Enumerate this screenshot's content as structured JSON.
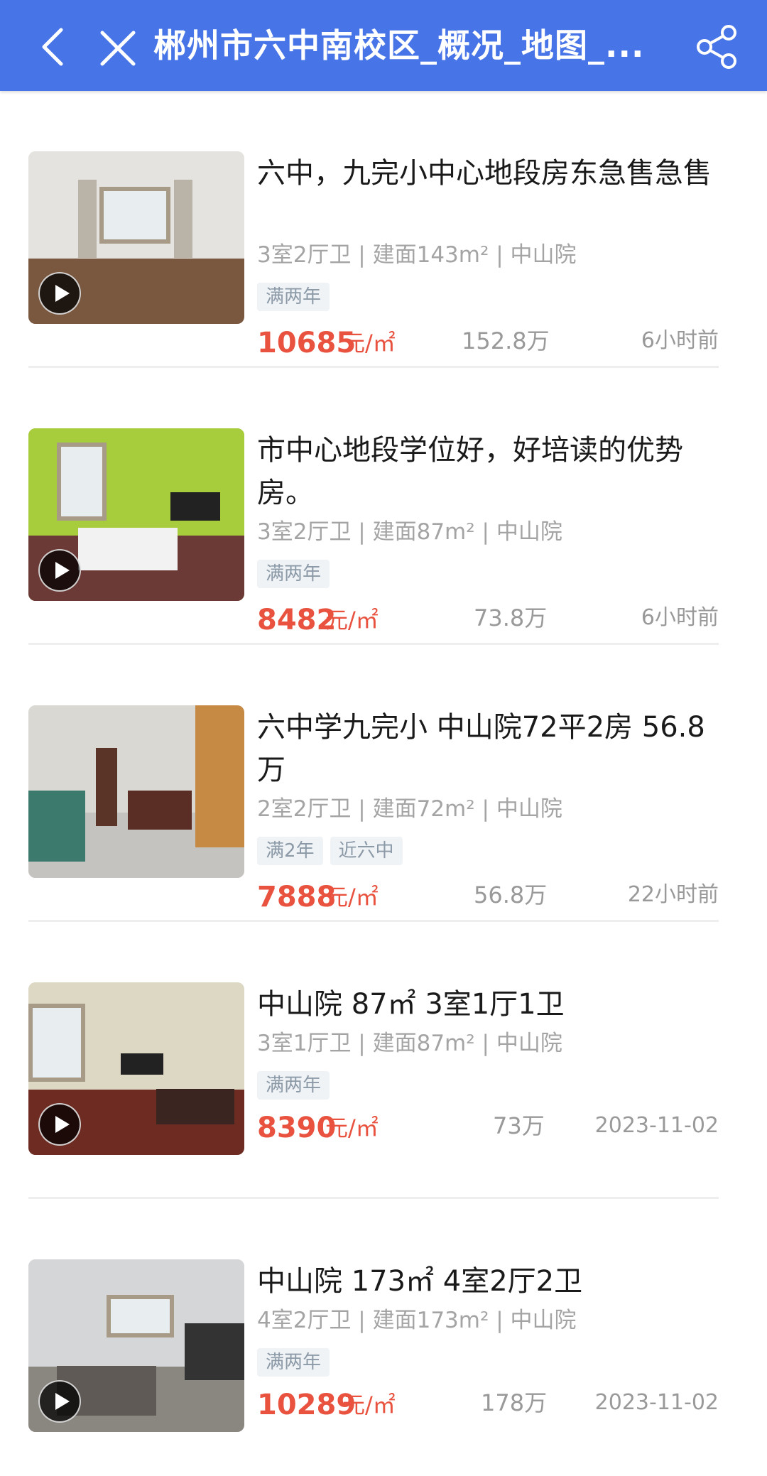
{
  "header": {
    "title": "郴州市六中南校区_概况_地图_...",
    "background": "#4774e6"
  },
  "colors": {
    "price": "#e8523f",
    "meta": "#a4a4a4",
    "tag_bg": "#f0f3f6",
    "tag_text": "#8c9aa8"
  },
  "listings": [
    {
      "title": "六中，九完小中心地段房东急售急售",
      "specs": "3室2厅卫 | 建面143m² | 中山院",
      "tags": [
        "满两年"
      ],
      "unit_price": "10685",
      "unit_label": "元/㎡",
      "total": "152.8万",
      "time": "6小时前"
    },
    {
      "title": "市中心地段学位好，好培读的优势房。",
      "specs": "3室2厅卫 | 建面87m² | 中山院",
      "tags": [
        "满两年"
      ],
      "unit_price": "8482",
      "unit_label": "元/㎡",
      "total": "73.8万",
      "time": "6小时前"
    },
    {
      "title": "六中学九完小 中山院72平2房 56.8万",
      "specs": "2室2厅卫 | 建面72m² | 中山院",
      "tags": [
        "满2年",
        "近六中"
      ],
      "unit_price": "7888",
      "unit_label": "元/㎡",
      "total": "56.8万",
      "time": "22小时前"
    },
    {
      "title": "中山院 87㎡ 3室1厅1卫",
      "specs": "3室1厅卫 | 建面87m² | 中山院",
      "tags": [
        "满两年"
      ],
      "unit_price": "8390",
      "unit_label": "元/㎡",
      "total": "73万",
      "time": "2023-11-02"
    },
    {
      "title": "中山院 173㎡ 4室2厅2卫",
      "specs": "4室2厅卫 | 建面173m² | 中山院",
      "tags": [
        "满两年"
      ],
      "unit_price": "10289",
      "unit_label": "元/㎡",
      "total": "178万",
      "time": "2023-11-02"
    }
  ]
}
